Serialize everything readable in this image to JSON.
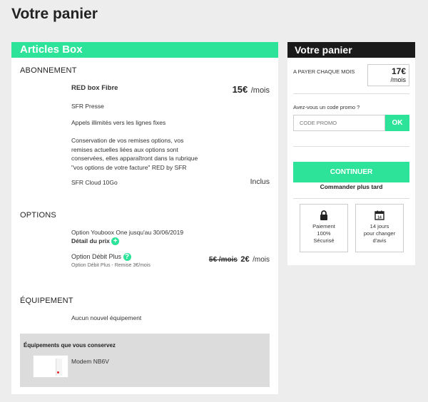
{
  "page_title": "Votre panier",
  "left": {
    "header": "Articles Box",
    "abonnement": {
      "title": "ABONNEMENT",
      "product": "RED box Fibre",
      "price": "15€",
      "price_unit": "/mois",
      "items": [
        "SFR Presse",
        "Appels illimités vers les lignes fixes"
      ],
      "note_lines": [
        "Conservation de vos remises options, vos",
        "remises actuelles liées aux options sont",
        "conservées, elles apparaîtront dans la rubrique",
        "\"vos options de votre facture\" RED by SFR"
      ],
      "cloud_label": "SFR Cloud 10Go",
      "cloud_price": "Inclus"
    },
    "options": {
      "title": "OPTIONS",
      "youboox": "Option Youboox One jusqu'au 30/06/2019",
      "detail_link": "Détail du prix",
      "debit_label": "Option Débit Plus",
      "old_price": "5€ /mois",
      "new_price": "2€",
      "new_price_unit": "/mois",
      "debit_sub": "Option Débit Plus - Remise 3€/mois"
    },
    "equipement": {
      "title": "ÉQUIPEMENT",
      "none": "Aucun nouvel équipement",
      "kept_title": "Équipements que vous conservez",
      "modem": "Modem NB6V"
    }
  },
  "right": {
    "header": "Votre panier",
    "monthly_label": "A PAYER CHAQUE MOIS",
    "monthly_price": "17€",
    "monthly_unit": "/mois",
    "promo_question": "Avez-vous un code promo ?",
    "promo_placeholder": "CODE PROMO",
    "promo_button": "OK",
    "continue_button": "CONTINUER",
    "later_link": "Commander plus tard",
    "payment": [
      "Paiement",
      "100%",
      "Sécurisé"
    ],
    "days": [
      "14 jours",
      "pour changer",
      "d'avis"
    ]
  },
  "colors": {
    "accent": "#2de39a",
    "dark": "#1a1a1a",
    "background": "#ededed"
  }
}
